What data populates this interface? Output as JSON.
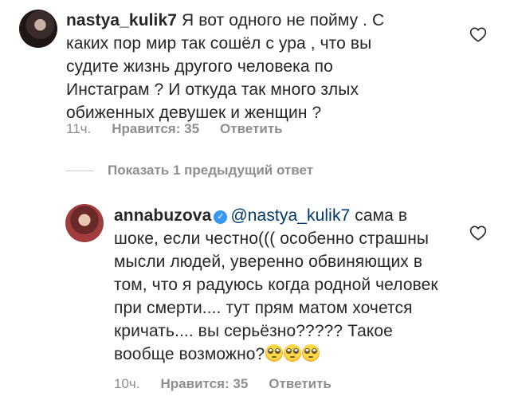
{
  "comments": [
    {
      "username": "nastya_kulik7",
      "text": "Я вот одного не пойму . С каких пор мир так сошёл с ура , что вы судите жизнь другого человека по Инстаграм ? И откуда так много злых обиженных девушек и женщин ?",
      "time": "11ч.",
      "likes_label": "Нравится: 35",
      "reply_label": "Ответить",
      "verified": false
    },
    {
      "username": "annabuzova",
      "mention": "@nastya_kulik7",
      "text": "сама в шоке, если честно((( особенно страшны мысли людей, уверенно обвиняющих в том, что я радуюсь когда родной человек при смерти.... тут прям матом хочется кричать.... вы серьёзно????? Такое вообще возможно?",
      "emoji_icon": "face-with-rolling-eyes-icon",
      "emoji_count": 3,
      "time": "10ч.",
      "likes_label": "Нравится: 35",
      "reply_label": "Ответить",
      "verified": true
    }
  ],
  "show_replies_label": "Показать 1 предыдущий ответ",
  "colors": {
    "text": "#262626",
    "muted": "#8e8e8e",
    "mention": "#00376b",
    "verified": "#3897f0"
  }
}
